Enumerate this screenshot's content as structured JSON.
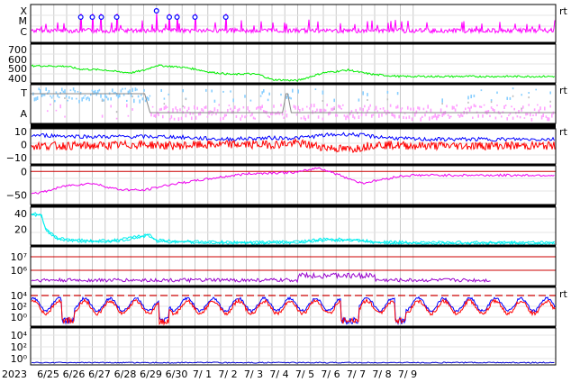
{
  "date_axis": {
    "year_label": "2023",
    "labels": [
      "6/25",
      "6/26",
      "6/27",
      "6/28",
      "6/29",
      "6/30",
      "7/ 1",
      "7/ 2",
      "7/ 3",
      "7/ 4",
      "7/ 5",
      "7/ 6",
      "7/ 7",
      "7/ 8",
      "7/ 9"
    ]
  },
  "colors": {
    "grid": "#c8c8c8",
    "xray_class": "#ff00ff",
    "flare_marker": "#0000ff",
    "solar_wind_speed": "#00ee00",
    "t_a_blue": "#87ceff",
    "t_a_pink": "#ffa0ff",
    "t_a_gray": "#888888",
    "imf_total": "#0000ff",
    "imf_bz": "#ff0000",
    "panel4": "#ee00ee",
    "panel5": "#00eeee",
    "electron_flux": "#9900cc",
    "threshold_line": "#cc0000",
    "proton_flux_blue": "#0000ff",
    "proton_flux_red": "#ff0000",
    "bottom_series": "#0000cc"
  },
  "chart_data": [
    {
      "type": "line",
      "panel": "xray-class",
      "y_ticks": [
        "X",
        "M",
        "C"
      ],
      "flare_marker_days": [
        1.55,
        2.0,
        2.35,
        2.95,
        4.5,
        5.0,
        5.3,
        6.0,
        7.2
      ]
    },
    {
      "type": "line",
      "panel": "solar-wind-speed",
      "y_ticks": [
        "700",
        "600",
        "500",
        "400"
      ],
      "ylim": [
        330,
        750
      ],
      "x": [
        0,
        1,
        1.5,
        2.5,
        3.0,
        3.5,
        4.0,
        4.5,
        5.0,
        5.5,
        6.0,
        6.5,
        6.8,
        7.5,
        8.0,
        8.5,
        9.0,
        10.0,
        11.0,
        12.0,
        12.5,
        13.0,
        14.0,
        14.5
      ],
      "values": [
        515,
        510,
        480,
        470,
        450,
        440,
        465,
        520,
        510,
        500,
        480,
        450,
        440,
        420,
        430,
        420,
        365,
        355,
        440,
        470,
        440,
        420,
        400,
        400
      ]
    },
    {
      "type": "line",
      "panel": "t-a-state",
      "y_ticks": [
        "T",
        "A"
      ],
      "switch_days": [
        4.25,
        9.55,
        9.75
      ]
    },
    {
      "type": "line",
      "panel": "imf",
      "y_ticks": [
        "10",
        "0",
        "−10"
      ],
      "ylim": [
        -15,
        12
      ],
      "series": [
        {
          "x": [
            0,
            2,
            4,
            5,
            7,
            9,
            10,
            11,
            12,
            13,
            14.5
          ],
          "values": [
            7,
            6,
            6,
            6,
            4,
            5,
            5,
            7,
            8,
            6,
            4
          ]
        },
        {
          "x": [
            0,
            2,
            4,
            5,
            7,
            9,
            10,
            11,
            12,
            13,
            14.5
          ],
          "values": [
            -1,
            -1,
            0,
            -1,
            0,
            0,
            1,
            -2,
            -4,
            0,
            -1
          ]
        }
      ]
    },
    {
      "type": "line",
      "panel": "panel-4",
      "y_ticks": [
        "0",
        "−50"
      ],
      "ylim": [
        -70,
        12
      ],
      "x": [
        0,
        1,
        2,
        3,
        4,
        5,
        6,
        7,
        8,
        9,
        10,
        10.8,
        11.5,
        12.5,
        13.2,
        14,
        14.5
      ],
      "values": [
        -45,
        -30,
        -25,
        -38,
        -40,
        -28,
        -20,
        -12,
        -5,
        -3,
        -2,
        8,
        -5,
        -25,
        -18,
        -10,
        -8
      ]
    },
    {
      "type": "line",
      "panel": "panel-5",
      "y_ticks": [
        "40",
        "20"
      ],
      "ylim": [
        0,
        48
      ],
      "x": [
        0,
        0.2,
        0.6,
        1,
        2,
        3,
        4.2,
        4.5,
        5,
        6,
        8,
        10,
        11,
        12,
        13,
        14.5
      ],
      "values": [
        38,
        18,
        8,
        6,
        4,
        5,
        12,
        5,
        4,
        3,
        2,
        3,
        6,
        6,
        3,
        2
      ]
    },
    {
      "type": "line",
      "panel": "electron-flux",
      "y_ticks": [
        "10⁷",
        "10⁶"
      ],
      "threshold_levels": [
        "10⁷",
        "10⁶"
      ]
    },
    {
      "type": "line",
      "panel": "proton-flux",
      "y_ticks": [
        "10⁴",
        "10²",
        "10⁰"
      ],
      "threshold_level": "10⁴"
    },
    {
      "type": "line",
      "panel": "bottom-panel",
      "y_ticks": [
        "10⁴",
        "10²",
        "10⁰"
      ]
    }
  ]
}
